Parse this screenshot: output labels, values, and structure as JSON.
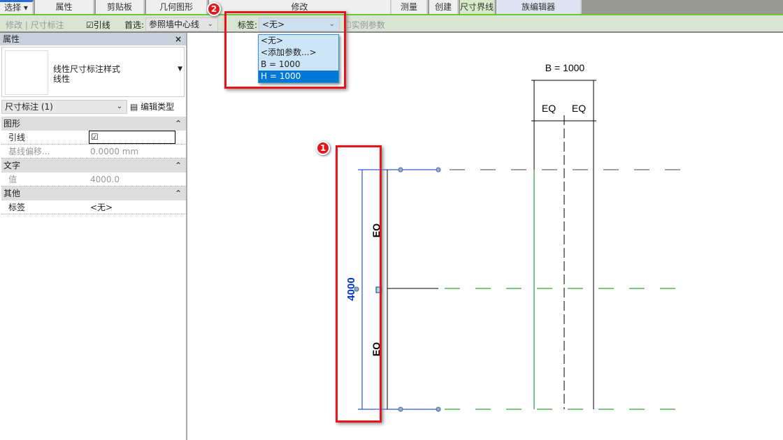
{
  "ribbon_tabs": [
    "选择 ▾",
    "属性",
    "剪贴板",
    "几何图形",
    "修改",
    "测量",
    "创建",
    "尺寸界线",
    "族编辑器"
  ],
  "options_bar": {
    "modify_label": "修改 | 尺寸标注",
    "leader_label": "引线",
    "leader_checked": true,
    "prefer_label": "首选:",
    "prefer_value": "参照墙中心线",
    "label_label": "标签:",
    "label_value": "<无>",
    "instance_param_label": "实例参数"
  },
  "label_dropdown": {
    "options": [
      "<无>",
      "<添加参数...>",
      "B = 1000",
      "H = 1000"
    ],
    "highlighted": "H = 1000"
  },
  "properties": {
    "title": "属性",
    "close": "×",
    "type_name": "线性尺寸标注样式",
    "type_sub": "线性",
    "selector": "尺寸标注 (1)",
    "edit_type": "编辑类型",
    "groups": [
      {
        "name": "图形",
        "rows": [
          {
            "k": "引线",
            "v": "☑"
          },
          {
            "k": "基线偏移...",
            "v": "0.0000 mm"
          }
        ]
      },
      {
        "name": "文字",
        "rows": [
          {
            "k": "值",
            "v": "4000.0"
          }
        ]
      },
      {
        "name": "其他",
        "rows": [
          {
            "k": "标签",
            "v": "<无>"
          }
        ]
      }
    ]
  },
  "drawing": {
    "dim_value": "4000",
    "eq": "EQ",
    "b_label": "B = 1000"
  },
  "annotations": [
    "1",
    "2"
  ],
  "colors": {
    "highlight": "#e5161b",
    "dim_blue": "#0033cc",
    "ref_green": "#008000"
  }
}
